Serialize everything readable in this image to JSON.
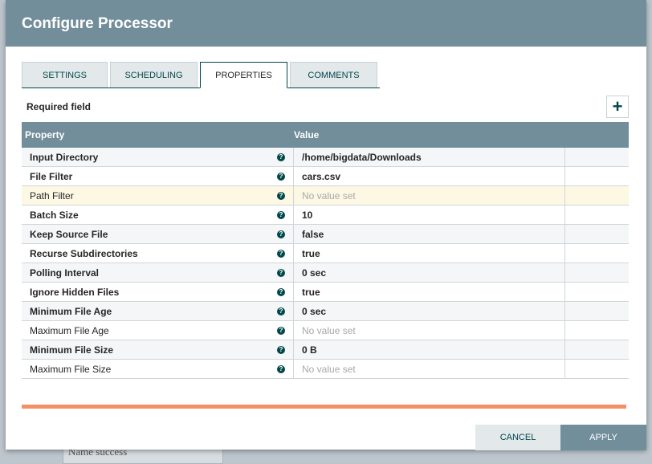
{
  "background": {
    "item_text": "Name  success"
  },
  "dialog": {
    "title": "Configure Processor"
  },
  "tabs": [
    {
      "label": "SETTINGS"
    },
    {
      "label": "SCHEDULING"
    },
    {
      "label": "PROPERTIES"
    },
    {
      "label": "COMMENTS"
    }
  ],
  "required_label": "Required field",
  "add_button": "+",
  "table": {
    "headers": {
      "property": "Property",
      "value": "Value"
    },
    "rows": [
      {
        "property": "Input Directory",
        "value": "/home/bigdata/Downloads",
        "required": true
      },
      {
        "property": "File Filter",
        "value": "cars.csv",
        "required": true
      },
      {
        "property": "Path Filter",
        "value": "No value set",
        "required": false
      },
      {
        "property": "Batch Size",
        "value": "10",
        "required": true
      },
      {
        "property": "Keep Source File",
        "value": "false",
        "required": true
      },
      {
        "property": "Recurse Subdirectories",
        "value": "true",
        "required": true
      },
      {
        "property": "Polling Interval",
        "value": "0 sec",
        "required": true
      },
      {
        "property": "Ignore Hidden Files",
        "value": "true",
        "required": true
      },
      {
        "property": "Minimum File Age",
        "value": "0 sec",
        "required": true
      },
      {
        "property": "Maximum File Age",
        "value": "No value set",
        "required": false
      },
      {
        "property": "Minimum File Size",
        "value": "0 B",
        "required": true
      },
      {
        "property": "Maximum File Size",
        "value": "No value set",
        "required": false
      }
    ]
  },
  "help_glyph": "?",
  "buttons": {
    "cancel": "CANCEL",
    "apply": "APPLY"
  }
}
